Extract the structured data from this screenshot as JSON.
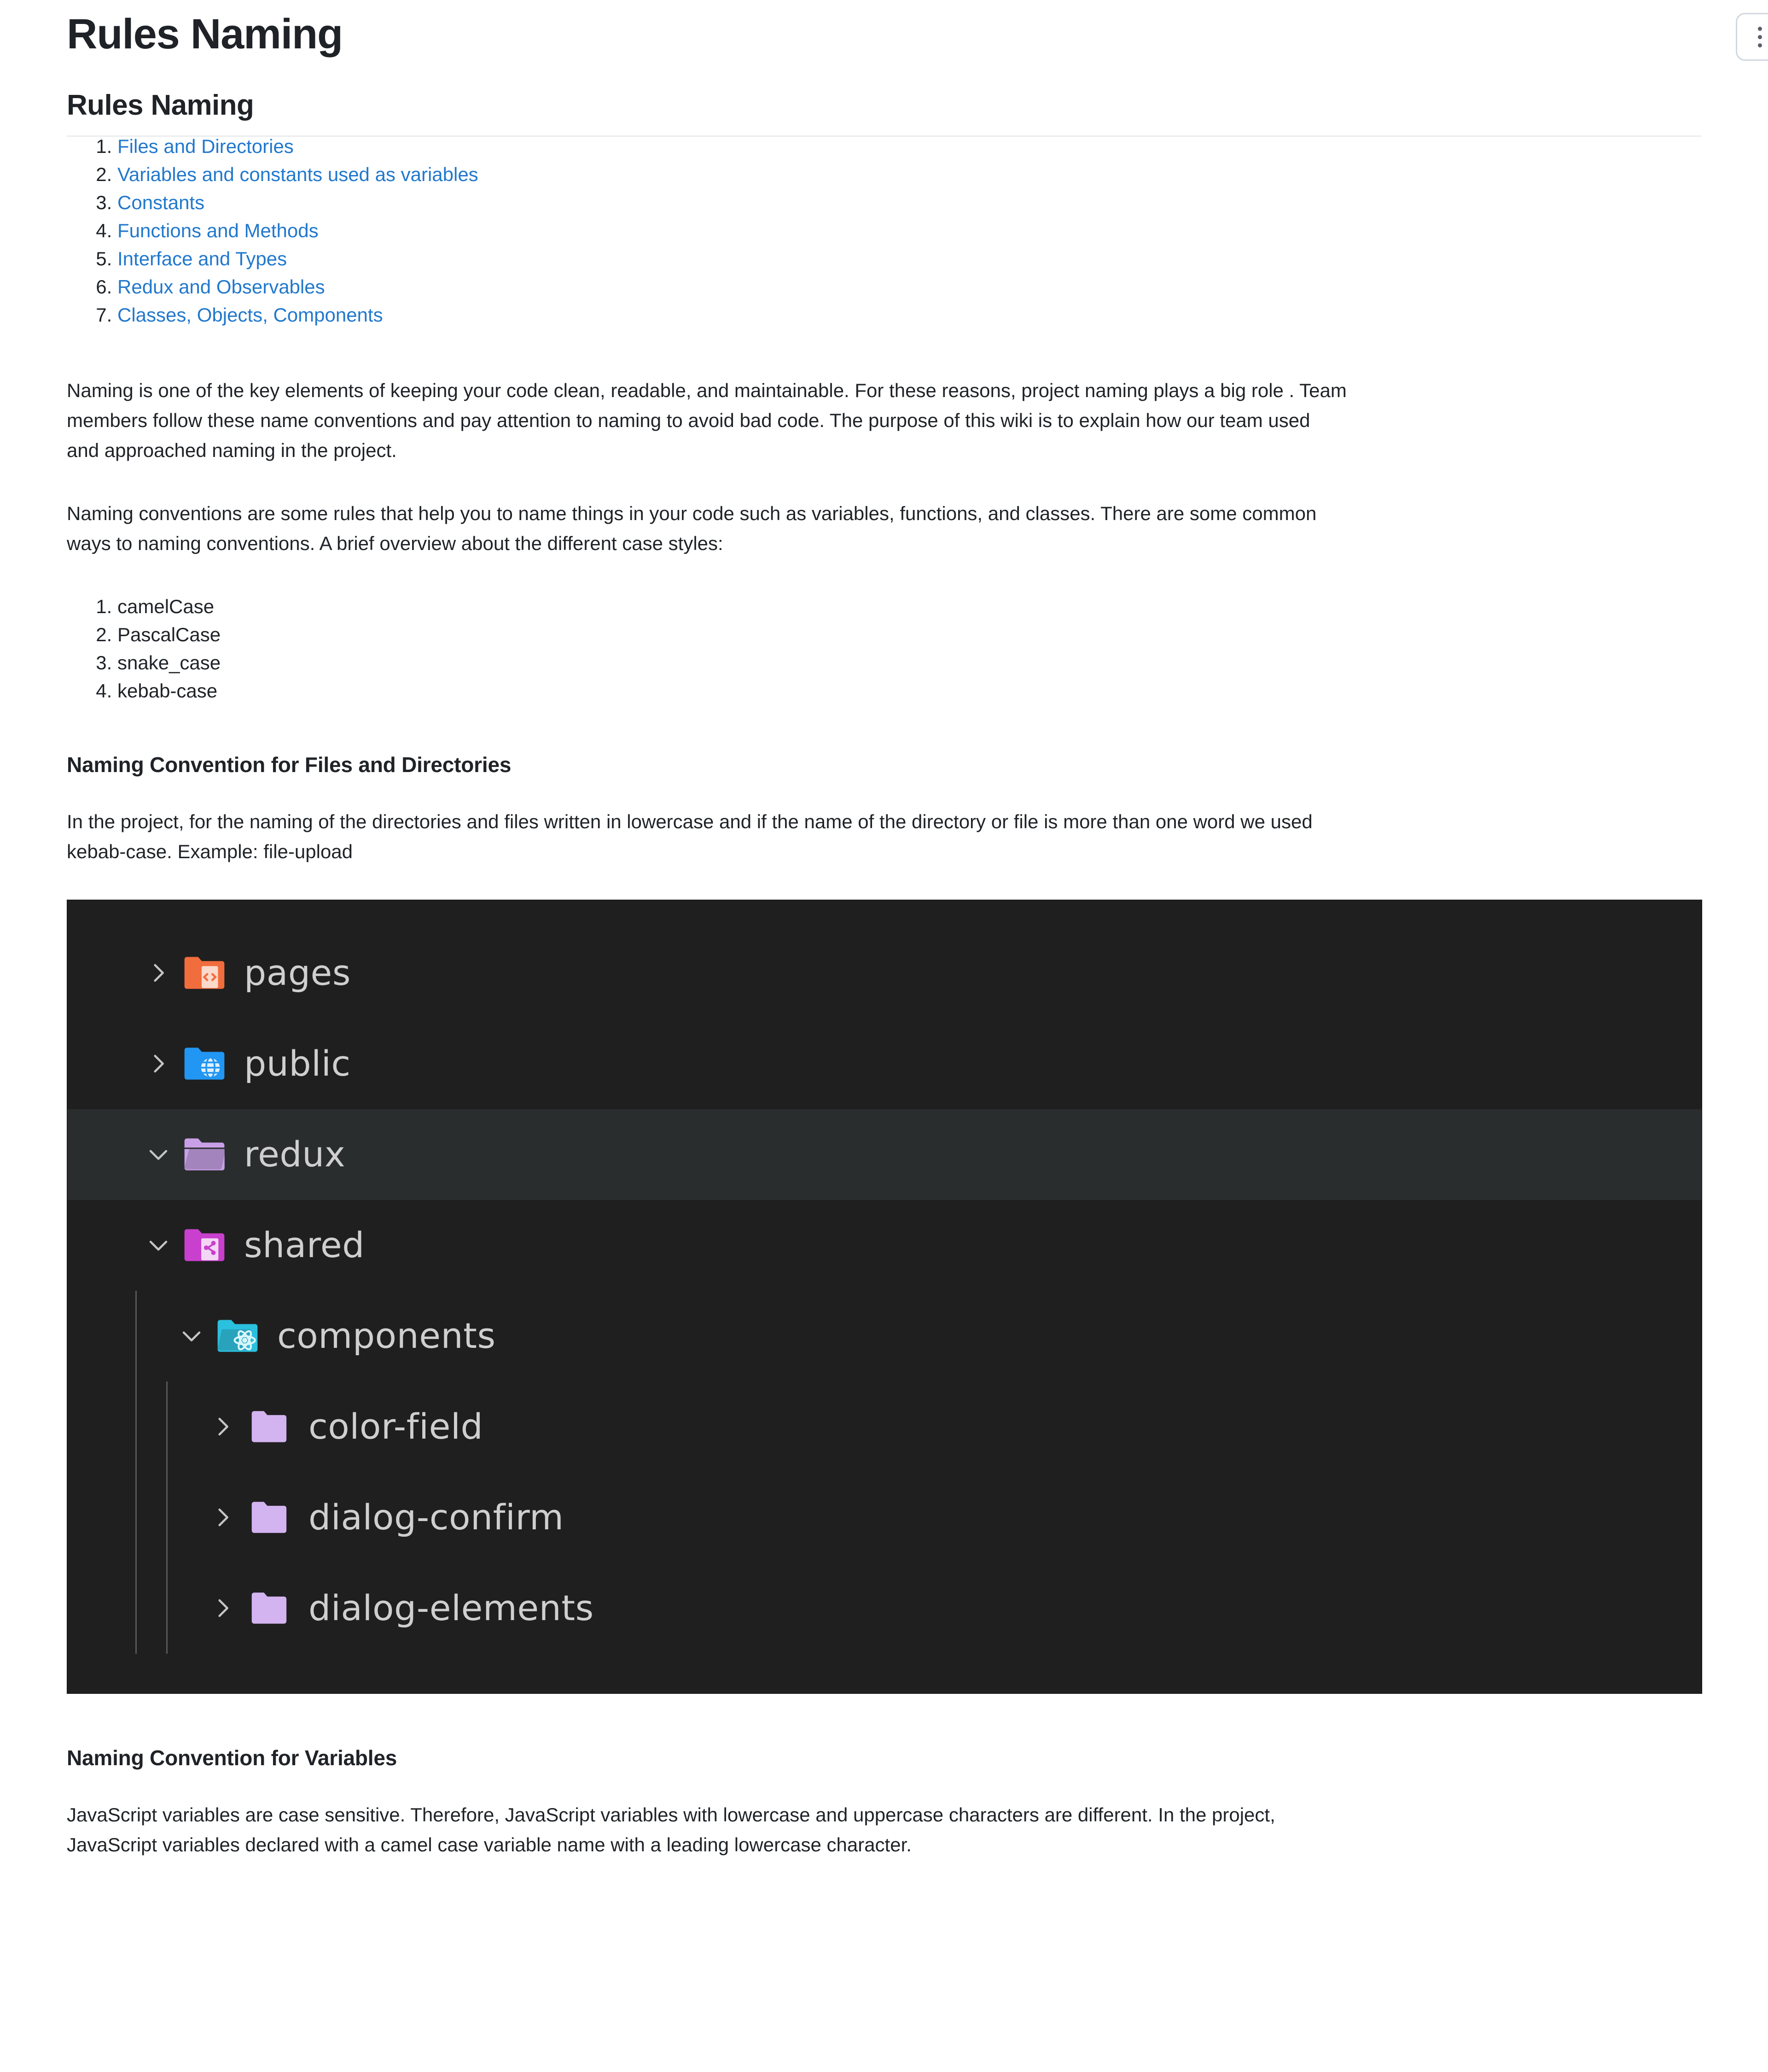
{
  "header": {
    "title": "Rules Naming",
    "menu_button_icon": "kebab-menu-icon"
  },
  "article": {
    "heading": "Rules Naming",
    "toc": [
      {
        "label": "Files and Directories"
      },
      {
        "label": "Variables and constants used as variables"
      },
      {
        "label": "Constants"
      },
      {
        "label": "Functions and Methods"
      },
      {
        "label": "Interface and Types"
      },
      {
        "label": "Redux and Observables"
      },
      {
        "label": "Classes, Objects, Components"
      }
    ],
    "intro_paragraph": {
      "line1": "Naming is one of the key elements of keeping your code clean, readable, and maintainable. For these reasons, project naming plays a big role . Team",
      "line2": "members follow these name conventions and pay attention to naming to avoid bad code. The purpose of this wiki is to explain how our team used",
      "line3": "and approached naming in the project."
    },
    "conventions_paragraph": {
      "line1": "Naming conventions are some rules that help you to name things in your code such as variables, functions, and classes. There are some common",
      "line2": "ways to naming conventions. A brief overview about the different case styles:"
    },
    "case_styles": [
      {
        "label": "camelCase"
      },
      {
        "label": "PascalCase"
      },
      {
        "label": "snake_case"
      },
      {
        "label": "kebab-case"
      }
    ],
    "files_section": {
      "heading": "Naming Convention for Files and Directories",
      "paragraph": {
        "line1": "In the project, for the naming of the directories and files written in lowercase and if the name of the directory or file is more than one word we used",
        "line2": "kebab-case. Example: file-upload"
      }
    },
    "variables_section": {
      "heading": "Naming Convention for Variables",
      "paragraph": {
        "line1": "JavaScript variables are case sensitive. Therefore, JavaScript variables with lowercase and uppercase characters are different. In the project,",
        "line2": "JavaScript variables declared with a camel case variable name with a leading lowercase character."
      }
    }
  },
  "file_tree": {
    "rows": [
      {
        "name": "pages",
        "chevron": "chevron-right-icon",
        "icon": "folder-pages-icon",
        "depth": 1,
        "selected": false
      },
      {
        "name": "public",
        "chevron": "chevron-right-icon",
        "icon": "folder-public-icon",
        "depth": 1,
        "selected": false
      },
      {
        "name": "redux",
        "chevron": "chevron-down-icon",
        "icon": "folder-redux-icon",
        "depth": 1,
        "selected": true
      },
      {
        "name": "shared",
        "chevron": "chevron-down-icon",
        "icon": "folder-shared-icon",
        "depth": 1,
        "selected": false
      },
      {
        "name": "components",
        "chevron": "chevron-down-icon",
        "icon": "folder-components-icon",
        "depth": 2,
        "selected": false
      },
      {
        "name": "color-field",
        "chevron": "chevron-right-icon",
        "icon": "folder-plain-icon",
        "depth": 3,
        "selected": false
      },
      {
        "name": "dialog-confirm",
        "chevron": "chevron-right-icon",
        "icon": "folder-plain-icon",
        "depth": 3,
        "selected": false
      },
      {
        "name": "dialog-elements",
        "chevron": "chevron-right-icon",
        "icon": "folder-plain-icon",
        "depth": 3,
        "selected": false
      }
    ],
    "colors": {
      "background": "#1f1f1f",
      "selected_row": "#2a2d2e",
      "text": "#cfcfcf",
      "folder_pages": "#f26d3d",
      "folder_public": "#2196f3",
      "folder_redux": "#c9a0e8",
      "folder_shared": "#c840cd",
      "folder_components": "#2bc0de",
      "folder_plain": "#d3b3f0"
    }
  },
  "colors": {
    "link": "#2178cd",
    "text": "#1f2328",
    "divider": "#eaecef",
    "button_border": "#d0d7de"
  }
}
